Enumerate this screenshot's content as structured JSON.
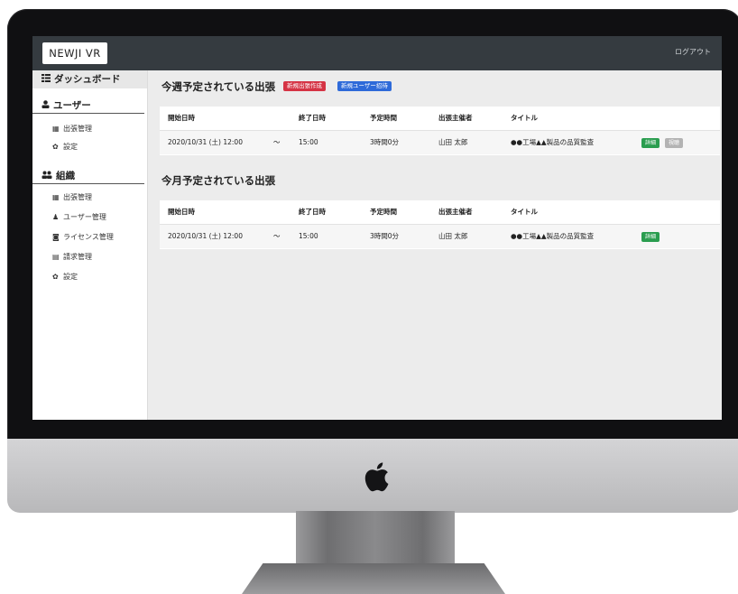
{
  "header": {
    "brand": "NEWJI VR",
    "logout": "ログアウト"
  },
  "sidebar": {
    "dashboard": "ダッシュボード",
    "user_section": "ユーザー",
    "user_items": [
      {
        "label": "出張管理",
        "icon": "calendar-icon"
      },
      {
        "label": "設定",
        "icon": "gear-icon"
      }
    ],
    "org_section": "組織",
    "org_items": [
      {
        "label": "出張管理",
        "icon": "calendar-icon"
      },
      {
        "label": "ユーザー管理",
        "icon": "user-manage-icon"
      },
      {
        "label": "ライセンス管理",
        "icon": "camera-icon"
      },
      {
        "label": "請求管理",
        "icon": "invoice-icon"
      },
      {
        "label": "設定",
        "icon": "gear-icon"
      }
    ]
  },
  "weekly": {
    "title": "今週予定されている出張",
    "new_trip_button": "新規出張作成",
    "invite_user_button": "新規ユーザー招待",
    "columns": [
      "開始日時",
      "終了日時",
      "予定時間",
      "出張主催者",
      "タイトル"
    ],
    "rows": [
      {
        "start": "2020/10/31 (土) 12:00",
        "tilde": "〜",
        "end": "15:00",
        "duration": "3時間0分",
        "organizer": "山田 太郎",
        "title": "●●工場▲▲製品の品質監査",
        "detail_button": "詳細",
        "view_button": "視聴"
      }
    ]
  },
  "monthly": {
    "title": "今月予定されている出張",
    "columns": [
      "開始日時",
      "終了日時",
      "予定時間",
      "出張主催者",
      "タイトル"
    ],
    "rows": [
      {
        "start": "2020/10/31 (土) 12:00",
        "tilde": "〜",
        "end": "15:00",
        "duration": "3時間0分",
        "organizer": "山田 太郎",
        "title": "●●工場▲▲製品の品質監査",
        "detail_button": "詳細"
      }
    ]
  },
  "colors": {
    "topbar": "#353b40",
    "danger": "#d53344",
    "primary": "#2e6ad9",
    "success": "#2a9d4f",
    "disabled": "#b3b3b3"
  }
}
